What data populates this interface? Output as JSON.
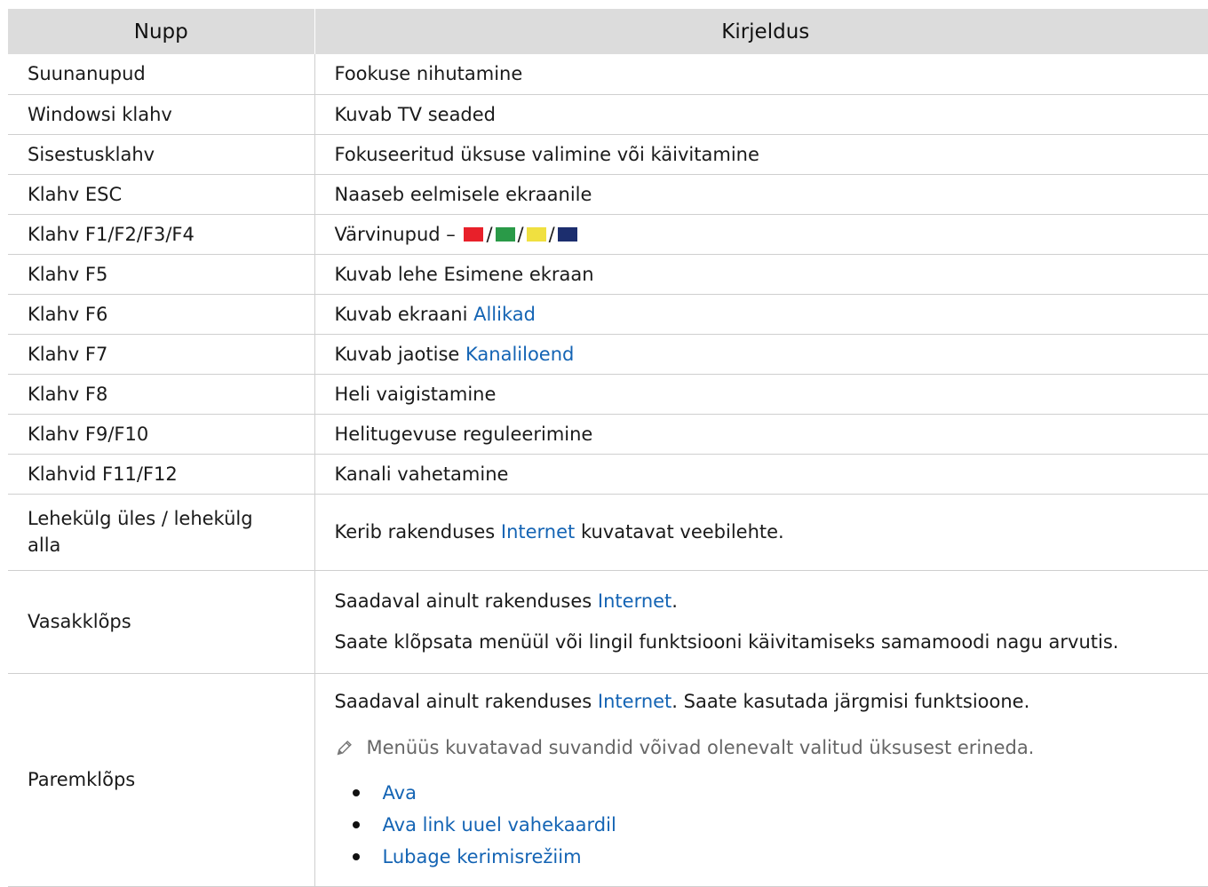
{
  "headers": {
    "key": "Nupp",
    "desc": "Kirjeldus"
  },
  "rows": [
    {
      "key": "Suunanupud",
      "desc": "Fookuse nihutamine"
    },
    {
      "key": "Windowsi klahv",
      "desc": "Kuvab TV seaded"
    },
    {
      "key": "Sisestusklahv",
      "desc": "Fokuseeritud üksuse valimine või käivitamine"
    },
    {
      "key": "Klahv ESC",
      "desc": "Naaseb eelmisele ekraanile"
    },
    {
      "key": "Klahv F1/F2/F3/F4",
      "desc_prefix": "Värvinupud – ",
      "sep": "/",
      "swatches": [
        "#e8202a",
        "#2a9a48",
        "#f0e040",
        "#1c2e6e"
      ]
    },
    {
      "key": "Klahv F5",
      "desc": "Kuvab lehe Esimene ekraan"
    },
    {
      "key": "Klahv F6",
      "desc_prefix": "Kuvab ekraani ",
      "link": "Allikad"
    },
    {
      "key": "Klahv F7",
      "desc_prefix": "Kuvab jaotise ",
      "link": "Kanaliloend"
    },
    {
      "key": "Klahv F8",
      "desc": "Heli vaigistamine"
    },
    {
      "key": "Klahv F9/F10",
      "desc": "Helitugevuse reguleerimine"
    },
    {
      "key": "Klahvid F11/F12",
      "desc": "Kanali vahetamine"
    },
    {
      "key": "Lehekülg üles / lehekülg alla",
      "desc_prefix": "Kerib rakenduses ",
      "link": "Internet",
      "desc_suffix": " kuvatavat veebilehte."
    },
    {
      "key": "Vasakklõps",
      "p1_prefix": "Saadaval ainult rakenduses ",
      "p1_link": "Internet",
      "p1_suffix": ".",
      "p2": "Saate klõpsata menüül või lingil funktsiooni käivitamiseks samamoodi nagu arvutis."
    },
    {
      "key": "Paremklõps",
      "p1_prefix": "Saadaval ainult rakenduses ",
      "p1_link": "Internet",
      "p1_suffix": ". Saate kasutada järgmisi funktsioone.",
      "note": "Menüüs kuvatavad suvandid võivad olenevalt valitud üksusest erineda.",
      "note_icon": "pencil-icon",
      "items": [
        "Ava",
        "Ava link uuel vahekaardil",
        "Lubage kerimisrežiim"
      ]
    }
  ]
}
